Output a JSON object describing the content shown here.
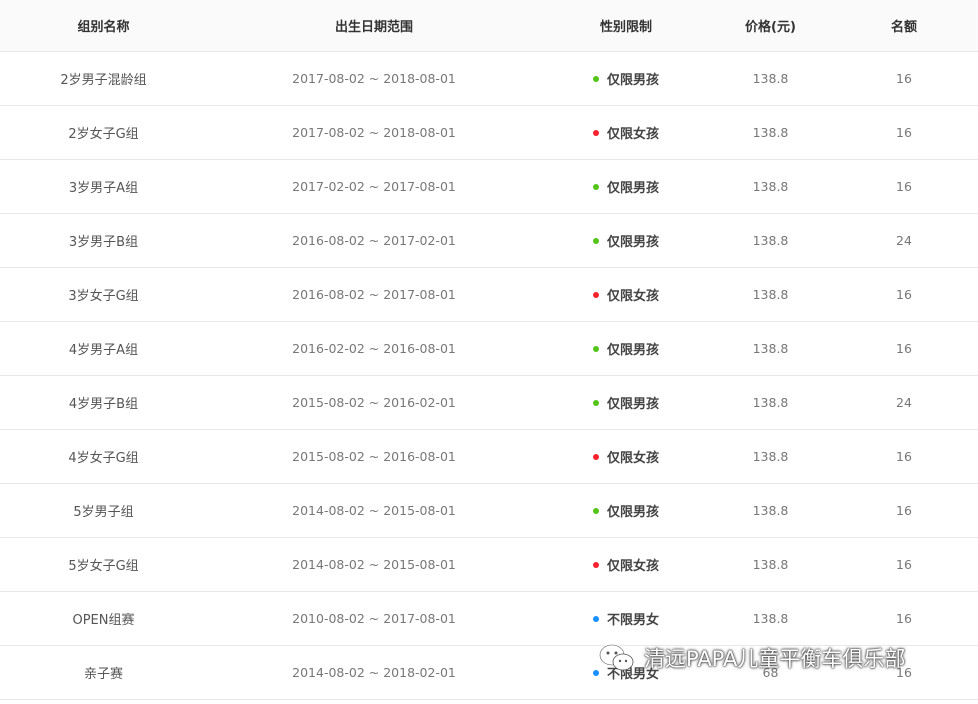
{
  "columns": {
    "group_name": "组别名称",
    "birth_range": "出生日期范围",
    "gender": "性别限制",
    "price": "价格(元)",
    "quota": "名额"
  },
  "rows": [
    {
      "name": "2岁男子混龄组",
      "range": "2017-08-02 ~ 2018-08-01",
      "gender": "仅限男孩",
      "gender_type": "male",
      "price": "138.8",
      "quota": "16"
    },
    {
      "name": "2岁女子G组",
      "range": "2017-08-02 ~ 2018-08-01",
      "gender": "仅限女孩",
      "gender_type": "female",
      "price": "138.8",
      "quota": "16"
    },
    {
      "name": "3岁男子A组",
      "range": "2017-02-02 ~ 2017-08-01",
      "gender": "仅限男孩",
      "gender_type": "male",
      "price": "138.8",
      "quota": "16"
    },
    {
      "name": "3岁男子B组",
      "range": "2016-08-02 ~ 2017-02-01",
      "gender": "仅限男孩",
      "gender_type": "male",
      "price": "138.8",
      "quota": "24"
    },
    {
      "name": "3岁女子G组",
      "range": "2016-08-02 ~ 2017-08-01",
      "gender": "仅限女孩",
      "gender_type": "female",
      "price": "138.8",
      "quota": "16"
    },
    {
      "name": "4岁男子A组",
      "range": "2016-02-02 ~ 2016-08-01",
      "gender": "仅限男孩",
      "gender_type": "male",
      "price": "138.8",
      "quota": "16"
    },
    {
      "name": "4岁男子B组",
      "range": "2015-08-02 ~ 2016-02-01",
      "gender": "仅限男孩",
      "gender_type": "male",
      "price": "138.8",
      "quota": "24"
    },
    {
      "name": "4岁女子G组",
      "range": "2015-08-02 ~ 2016-08-01",
      "gender": "仅限女孩",
      "gender_type": "female",
      "price": "138.8",
      "quota": "16"
    },
    {
      "name": "5岁男子组",
      "range": "2014-08-02 ~ 2015-08-01",
      "gender": "仅限男孩",
      "gender_type": "male",
      "price": "138.8",
      "quota": "16"
    },
    {
      "name": "5岁女子G组",
      "range": "2014-08-02 ~ 2015-08-01",
      "gender": "仅限女孩",
      "gender_type": "female",
      "price": "138.8",
      "quota": "16"
    },
    {
      "name": "OPEN组赛",
      "range": "2010-08-02 ~ 2017-08-01",
      "gender": "不限男女",
      "gender_type": "any",
      "price": "138.8",
      "quota": "16"
    },
    {
      "name": "亲子赛",
      "range": "2014-08-02 ~ 2018-02-01",
      "gender": "不限男女",
      "gender_type": "any",
      "price": "68",
      "quota": "16"
    }
  ],
  "colors": {
    "male": "#52c41a",
    "female": "#f5222d",
    "any": "#1890ff"
  },
  "watermark": {
    "text": "清远PAPA儿童平衡车俱乐部",
    "icon": "wechat-icon"
  }
}
